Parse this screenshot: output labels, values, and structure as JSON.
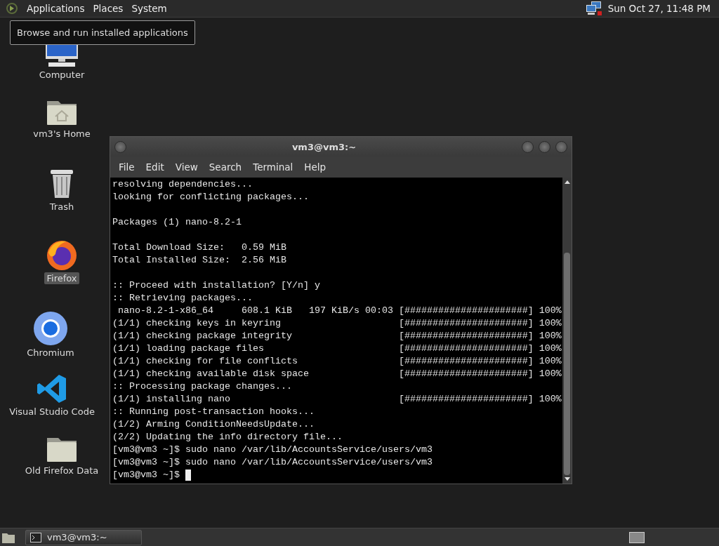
{
  "top_panel": {
    "menus": [
      "Applications",
      "Places",
      "System"
    ],
    "clock": "Sun Oct 27, 11:48 PM"
  },
  "tooltip": "Browse and run installed applications",
  "desktop_icons": [
    {
      "label": "Computer",
      "kind": "computer",
      "selected": false
    },
    {
      "label": "vm3's Home",
      "kind": "home",
      "selected": false
    },
    {
      "label": "Trash",
      "kind": "trash",
      "selected": false
    },
    {
      "label": "Firefox",
      "kind": "firefox",
      "selected": true
    },
    {
      "label": "Chromium",
      "kind": "chromium",
      "selected": false
    },
    {
      "label": "Visual Studio Code",
      "kind": "vscode",
      "selected": false
    },
    {
      "label": "Old Firefox Data",
      "kind": "folder",
      "selected": false
    }
  ],
  "terminal": {
    "title": "vm3@vm3:~",
    "menus": [
      "File",
      "Edit",
      "View",
      "Search",
      "Terminal",
      "Help"
    ],
    "lines": [
      {
        "kind": "text",
        "text": "resolving dependencies..."
      },
      {
        "kind": "text",
        "text": "looking for conflicting packages..."
      },
      {
        "kind": "blank"
      },
      {
        "kind": "text",
        "text": "Packages (1) nano-8.2-1"
      },
      {
        "kind": "blank"
      },
      {
        "kind": "text",
        "text": "Total Download Size:   0.59 MiB"
      },
      {
        "kind": "text",
        "text": "Total Installed Size:  2.56 MiB"
      },
      {
        "kind": "blank"
      },
      {
        "kind": "text",
        "text": ":: Proceed with installation? [Y/n] y"
      },
      {
        "kind": "text",
        "text": ":: Retrieving packages..."
      },
      {
        "kind": "text",
        "text": " nano-8.2-1-x86_64     608.1 KiB   197 KiB/s 00:03 [######################] 100%"
      },
      {
        "kind": "text",
        "text": "(1/1) checking keys in keyring                     [######################] 100%"
      },
      {
        "kind": "text",
        "text": "(1/1) checking package integrity                   [######################] 100%"
      },
      {
        "kind": "text",
        "text": "(1/1) loading package files                        [######################] 100%"
      },
      {
        "kind": "text",
        "text": "(1/1) checking for file conflicts                  [######################] 100%"
      },
      {
        "kind": "text",
        "text": "(1/1) checking available disk space                [######################] 100%"
      },
      {
        "kind": "text",
        "text": ":: Processing package changes..."
      },
      {
        "kind": "text",
        "text": "(1/1) installing nano                              [######################] 100%"
      },
      {
        "kind": "text",
        "text": ":: Running post-transaction hooks..."
      },
      {
        "kind": "text",
        "text": "(1/2) Arming ConditionNeedsUpdate..."
      },
      {
        "kind": "text",
        "text": "(2/2) Updating the info directory file..."
      },
      {
        "kind": "text",
        "text": "[vm3@vm3 ~]$ sudo nano /var/lib/AccountsService/users/vm3"
      },
      {
        "kind": "text",
        "text": "[vm3@vm3 ~]$ sudo nano /var/lib/AccountsService/users/vm3"
      },
      {
        "kind": "text",
        "text": "[vm3@vm3 ~]$ "
      }
    ],
    "cursor": true
  },
  "taskbar": {
    "tasks": [
      {
        "label": "vm3@vm3:~",
        "selected": false
      }
    ]
  }
}
